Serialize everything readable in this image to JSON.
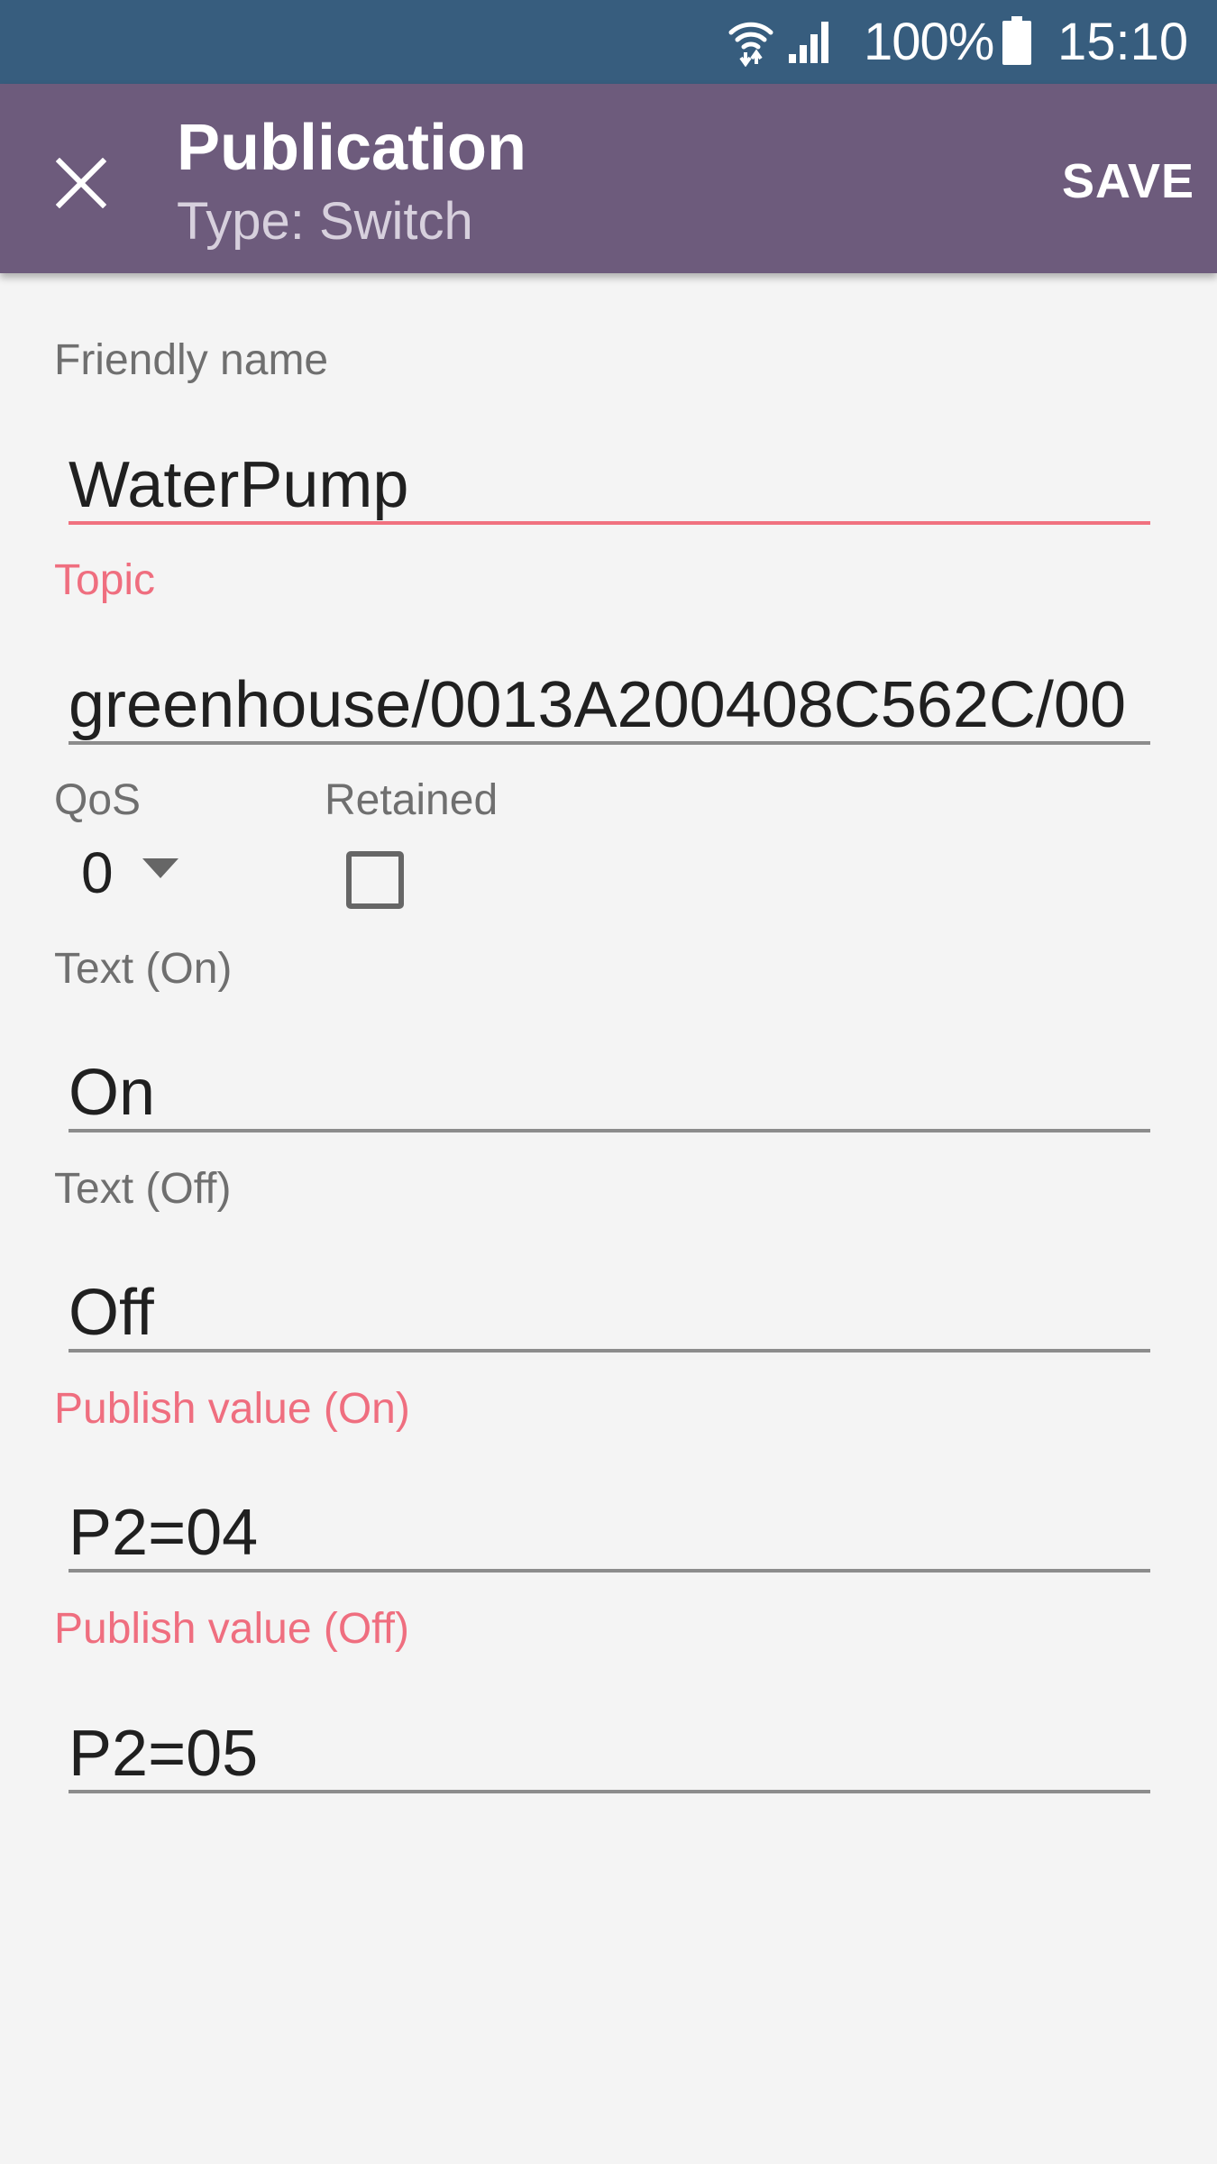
{
  "status_bar": {
    "wifi_icon": "wifi-icon",
    "signal_icon": "cell-signal-icon",
    "battery_percent": "100%",
    "battery_icon": "battery-full-icon",
    "time": "15:10"
  },
  "app_bar": {
    "close_icon": "close-icon",
    "title": "Publication",
    "subtitle": "Type: Switch",
    "save_label": "SAVE"
  },
  "form": {
    "friendly_name": {
      "label": "Friendly name",
      "value": "WaterPump"
    },
    "topic": {
      "label": "Topic",
      "value": "greenhouse/0013A200408C562C/00"
    },
    "qos": {
      "label": "QoS",
      "value": "0",
      "caret_icon": "dropdown-arrow-icon"
    },
    "retained": {
      "label": "Retained",
      "checked": false
    },
    "text_on": {
      "label": "Text (On)",
      "value": "On"
    },
    "text_off": {
      "label": "Text (Off)",
      "value": "Off"
    },
    "publish_on": {
      "label": "Publish value (On)",
      "value": "P2=04"
    },
    "publish_off": {
      "label": "Publish value (Off)",
      "value": "P2=05"
    }
  },
  "colors": {
    "status_bar": "#375d7e",
    "app_bar": "#6d5b7c",
    "accent": "#ef6e7f",
    "background": "#f4f4f4"
  }
}
